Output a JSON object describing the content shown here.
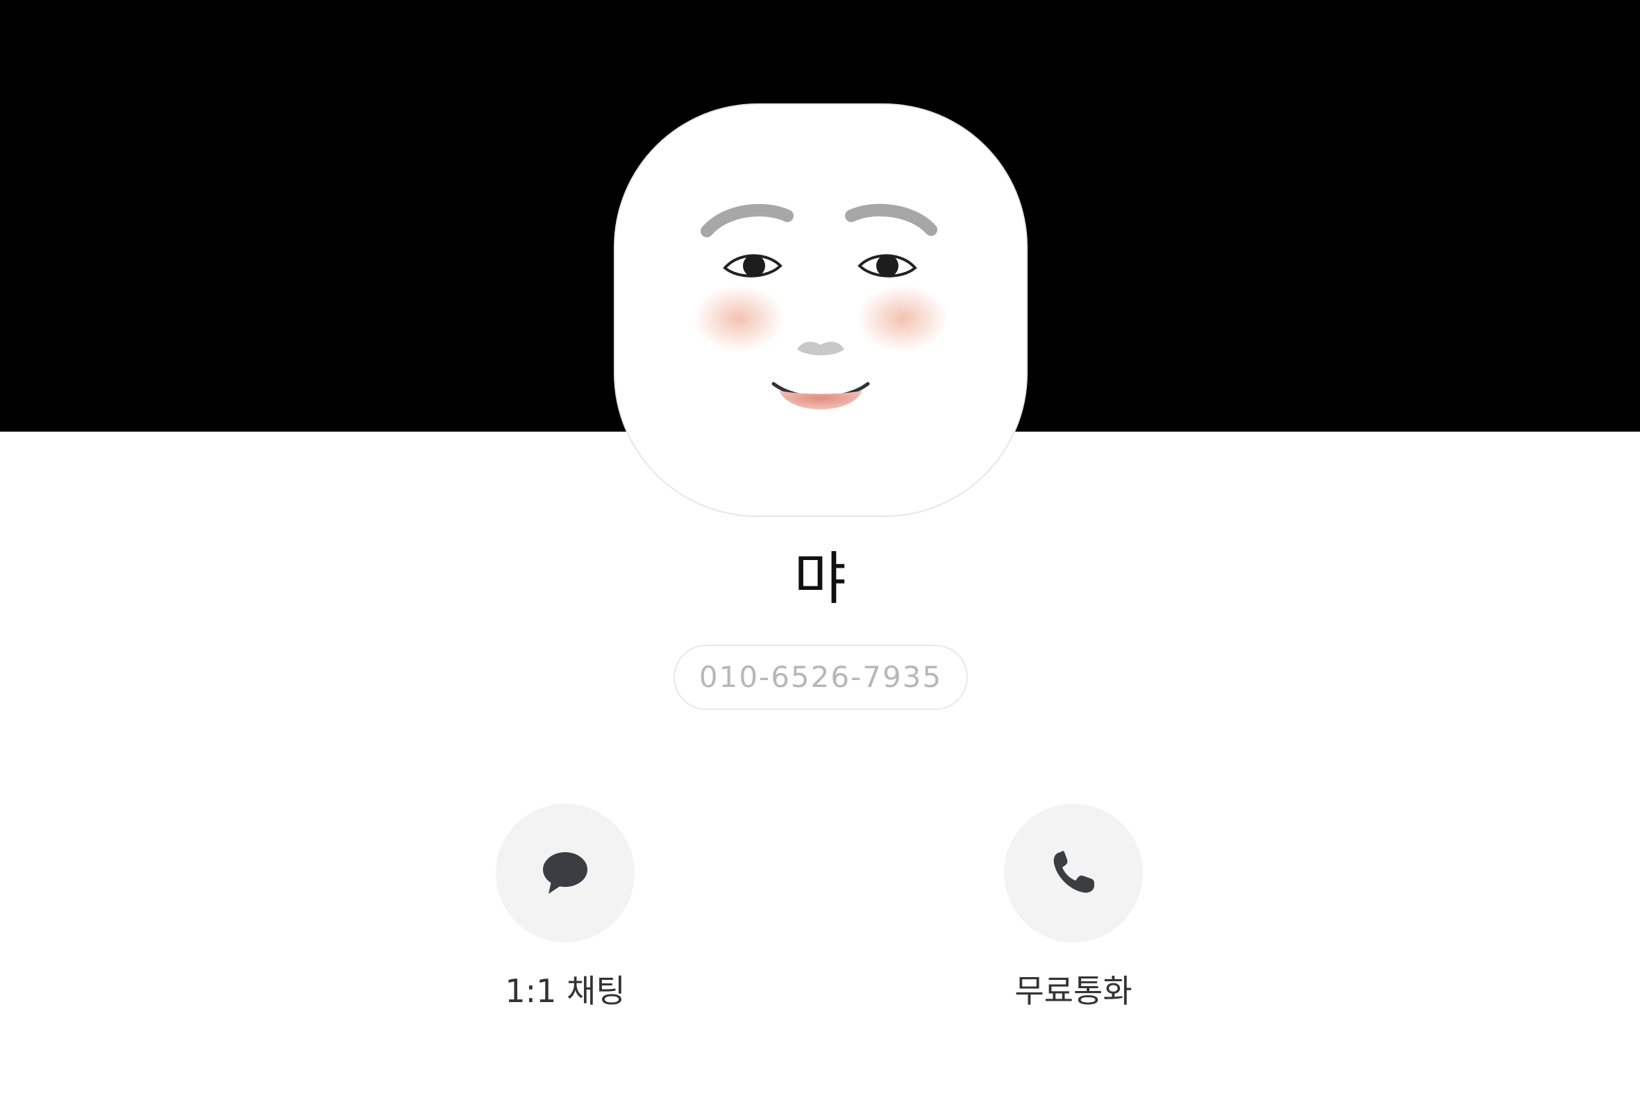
{
  "profile": {
    "name": "먀",
    "phone": "010-6526-7935",
    "avatar": "smiling-face-illustration"
  },
  "actions": [
    {
      "label": "1:1 채팅",
      "icon": "chat-bubble-icon"
    },
    {
      "label": "무료통화",
      "icon": "phone-icon"
    }
  ],
  "colors": {
    "cover": "#000000",
    "background": "#ffffff",
    "action_circle": "#f3f3f4",
    "icon": "#3c3d42",
    "phone_text": "#b7b7b7"
  }
}
